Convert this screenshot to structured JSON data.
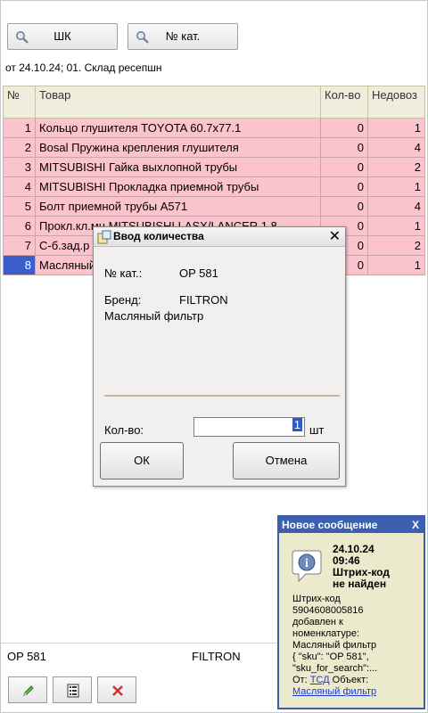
{
  "toolbar": {
    "shk_label": "ШК",
    "catalog_label": "№ кат."
  },
  "header": {
    "document_line": "от 24.10.24; 01. Склад ресепшн"
  },
  "table": {
    "columns": [
      "№",
      "Товар",
      "Кол-во",
      "Недовоз"
    ],
    "rows": [
      {
        "n": "1",
        "name": "Кольцо глушителя TOYOTA 60.7x77.1",
        "qty": "0",
        "under": "1"
      },
      {
        "n": "2",
        "name": "Bosal Пружина крепления глушителя",
        "qty": "0",
        "under": "4"
      },
      {
        "n": "3",
        "name": "MITSUBISHI Гайка выхлопной трубы",
        "qty": "0",
        "under": "2"
      },
      {
        "n": "4",
        "name": "MITSUBISHI Прокладка приемной трубы",
        "qty": "0",
        "under": "1"
      },
      {
        "n": "5",
        "name": "Болт приемной трубы A571",
        "qty": "0",
        "under": "4"
      },
      {
        "n": "6",
        "name": "Прокл.кл.мн.MITSUBISHI LASX/LANCER 1.8",
        "qty": "0",
        "under": "1"
      },
      {
        "n": "7",
        "name": "С-б.зад.р",
        "qty": "0",
        "under": "2"
      },
      {
        "n": "8",
        "name": "Масляный",
        "qty": "0",
        "under": "1"
      }
    ]
  },
  "dialog": {
    "title": "Ввод количества",
    "catalog_label": "№ кат.:",
    "catalog_value": "OP 581",
    "brand_label": "Бренд:",
    "brand_value": "FILTRON",
    "product_name": "Масляный фильтр",
    "qty_label": "Кол-во:",
    "qty_value": "1",
    "unit": "шт",
    "ok_label": "ОК",
    "cancel_label": "Отмена"
  },
  "notification": {
    "title": "Новое сообщение",
    "close": "X",
    "date": "24.10.24",
    "time": "09:46",
    "headline_1": "Штрих-код",
    "headline_2": "не найден",
    "body_lines": [
      "Штрих-код",
      "5904608005816",
      "добавлен к",
      "номенклатуре:",
      "Масляный фильтр",
      "{ \"sku\": \"OP 581\",",
      "\"sku_for_search\":..."
    ],
    "from_label": "От:",
    "from_link": "ТСД",
    "object_label": "Объект:",
    "object_link": "Масляный фильтр"
  },
  "footer": {
    "sku": "OP 581",
    "brand": "FILTRON"
  },
  "colors": {
    "row_bg": "#fbc3cb",
    "header_bg": "#efeddc",
    "selection": "#3b5ec8",
    "notify_bg": "#eceacc",
    "notify_head": "#3c5fb1"
  }
}
